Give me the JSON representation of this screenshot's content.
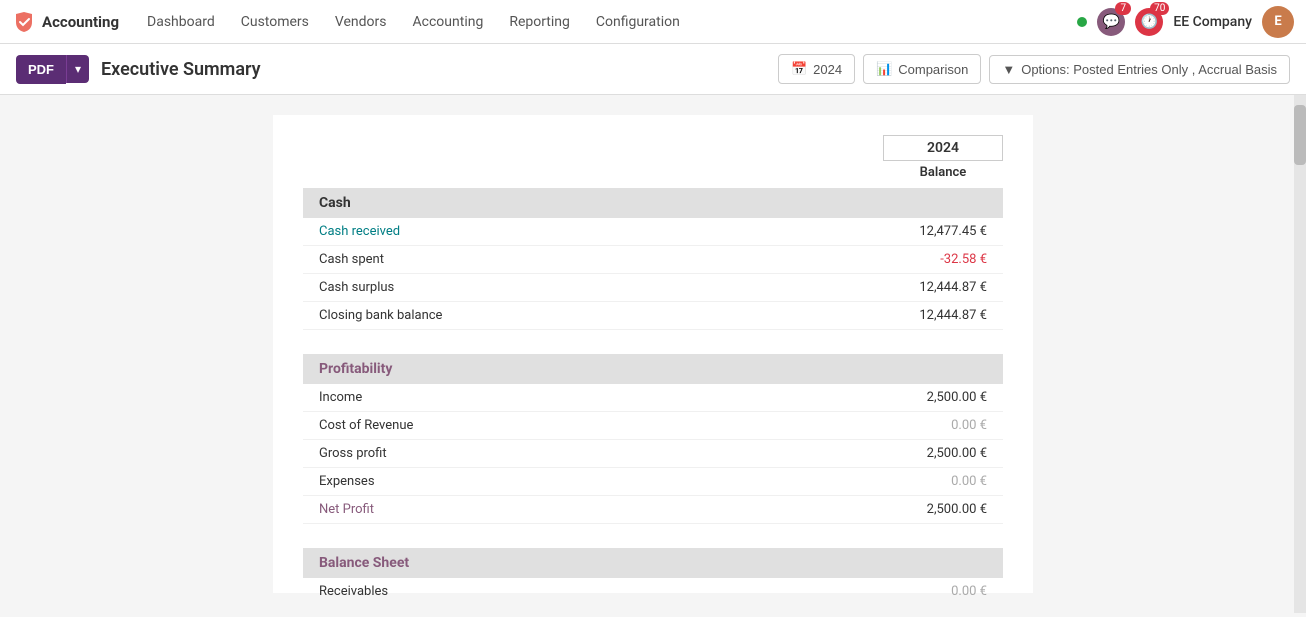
{
  "navbar": {
    "brand_icon_text": "✕",
    "brand_name": "Accounting",
    "nav_items": [
      {
        "label": "Dashboard",
        "active": false
      },
      {
        "label": "Customers",
        "active": false
      },
      {
        "label": "Vendors",
        "active": false
      },
      {
        "label": "Accounting",
        "active": false
      },
      {
        "label": "Reporting",
        "active": false
      },
      {
        "label": "Configuration",
        "active": false
      }
    ],
    "company_name": "EE Company",
    "notifications_count": "7",
    "todo_count": "70",
    "user_initials": "E"
  },
  "toolbar": {
    "pdf_label": "PDF",
    "dropdown_arrow": "▾",
    "page_title": "Executive Summary",
    "year_btn_label": "2024",
    "comparison_btn_label": "Comparison",
    "options_btn_label": "Options: Posted Entries Only , Accrual Basis"
  },
  "report": {
    "year_header": "2024",
    "balance_label": "Balance",
    "sections": [
      {
        "name": "Cash",
        "colored": false,
        "rows": [
          {
            "label": "Cash received",
            "label_type": "link",
            "value": "12,477.45 €",
            "value_type": "normal"
          },
          {
            "label": "Cash spent",
            "label_type": "normal",
            "value": "-32.58 €",
            "value_type": "negative"
          },
          {
            "label": "Cash surplus",
            "label_type": "normal",
            "value": "12,444.87 €",
            "value_type": "normal"
          },
          {
            "label": "Closing bank balance",
            "label_type": "normal",
            "value": "12,444.87 €",
            "value_type": "normal"
          }
        ]
      },
      {
        "name": "Profitability",
        "colored": true,
        "rows": [
          {
            "label": "Income",
            "label_type": "normal",
            "value": "2,500.00 €",
            "value_type": "normal"
          },
          {
            "label": "Cost of Revenue",
            "label_type": "normal",
            "value": "0.00 €",
            "value_type": "muted"
          },
          {
            "label": "Gross profit",
            "label_type": "normal",
            "value": "2,500.00 €",
            "value_type": "normal"
          },
          {
            "label": "Expenses",
            "label_type": "normal",
            "value": "0.00 €",
            "value_type": "muted"
          },
          {
            "label": "Net Profit",
            "label_type": "link-purple",
            "value": "2,500.00 €",
            "value_type": "normal"
          }
        ]
      },
      {
        "name": "Balance Sheet",
        "colored": true,
        "rows": [
          {
            "label": "Receivables",
            "label_type": "normal",
            "value": "0.00 €",
            "value_type": "muted"
          }
        ]
      }
    ]
  }
}
